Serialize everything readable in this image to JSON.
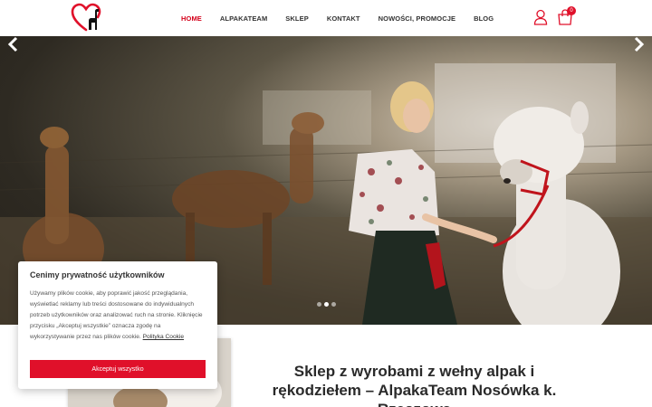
{
  "header": {
    "nav": [
      {
        "label": "HOME",
        "active": true
      },
      {
        "label": "ALPAKATEAM",
        "active": false
      },
      {
        "label": "SKLEP",
        "active": false
      },
      {
        "label": "KONTAKT",
        "active": false
      },
      {
        "label": "NOWOŚCI, PROMOCJE",
        "active": false
      },
      {
        "label": "BLOG",
        "active": false
      }
    ],
    "cart_count": "0",
    "icons": [
      "alpaca-heart-logo",
      "user-icon",
      "cart-icon"
    ]
  },
  "hero": {
    "slides_total": 3,
    "active_slide": 1,
    "icons": [
      "chevron-left-icon",
      "chevron-right-icon"
    ]
  },
  "main": {
    "headline": "Sklep z wyrobami z wełny alpak i rękodziełem – AlpakaTeam Nosówka k. Rzeszowa"
  },
  "cookie": {
    "title": "Cenimy prywatność użytkowników",
    "text": "Używamy plików cookie, aby poprawić jakość przeglądania, wyświetlać reklamy lub treści dostosowane do indywidualnych potrzeb użytkowników oraz analizować ruch na stronie. Kliknięcie przycisku „Akceptuj wszystkie” oznacza zgodę na wykorzystywanie przez nas plików cookie.",
    "link": "Polityka Cookie",
    "accept": "Akceptuj wszystko"
  },
  "colors": {
    "accent": "#e0102a",
    "nav_active": "#d4001a",
    "text": "#333333"
  }
}
